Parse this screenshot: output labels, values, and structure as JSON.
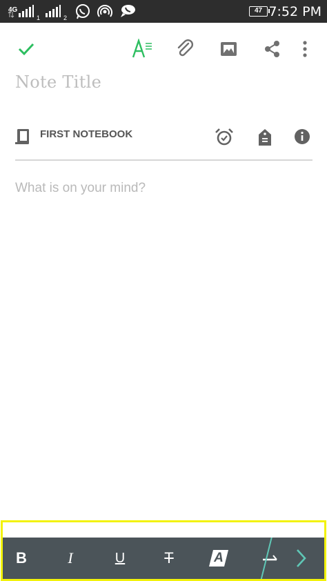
{
  "status_bar": {
    "network_type": "4G",
    "sim1": "1",
    "sim2": "2",
    "battery": "47",
    "time": "7:52 PM"
  },
  "toolbar": {
    "save_icon": "checkmark-icon",
    "format_icon": "text-format-icon",
    "attach_icon": "paperclip-icon",
    "image_icon": "image-icon",
    "share_icon": "share-icon",
    "more_icon": "more-vert-icon",
    "accent_color": "#2dbe60"
  },
  "note": {
    "title_placeholder": "Note Title",
    "notebook": "FIRST NOTEBOOK",
    "body_placeholder": "What is on your mind?"
  },
  "format_bar": {
    "bold": "B",
    "italic": "I",
    "underline": "U",
    "strikethrough": "T",
    "highlight": "A",
    "background_color": "#4b5459",
    "highlight_frame_color": "#f2f20a",
    "arrow_color": "#5fc7b6"
  }
}
